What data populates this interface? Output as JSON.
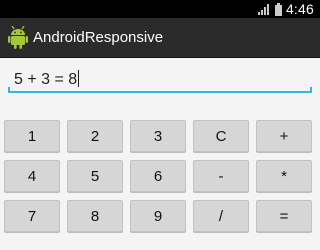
{
  "status_bar": {
    "time": "4:46",
    "signal_icon": "signal-bars-icon",
    "battery_icon": "battery-icon"
  },
  "app": {
    "title": "AndroidResponsive",
    "icon": "android-robot-icon"
  },
  "display": {
    "value": "5 + 3 = 8"
  },
  "keypad": {
    "rows": [
      [
        {
          "label": "1",
          "name": "key-1"
        },
        {
          "label": "2",
          "name": "key-2"
        },
        {
          "label": "3",
          "name": "key-3"
        },
        {
          "label": "C",
          "name": "key-clear"
        },
        {
          "label": "+",
          "name": "key-plus"
        }
      ],
      [
        {
          "label": "4",
          "name": "key-4"
        },
        {
          "label": "5",
          "name": "key-5"
        },
        {
          "label": "6",
          "name": "key-6"
        },
        {
          "label": "-",
          "name": "key-minus"
        },
        {
          "label": "*",
          "name": "key-multiply"
        }
      ],
      [
        {
          "label": "7",
          "name": "key-7"
        },
        {
          "label": "8",
          "name": "key-8"
        },
        {
          "label": "9",
          "name": "key-9"
        },
        {
          "label": "/",
          "name": "key-divide"
        },
        {
          "label": "=",
          "name": "key-equals"
        }
      ]
    ]
  },
  "colors": {
    "status_bar": "#000000",
    "action_bar": "#2b2b2b",
    "accent": "#33b5e5",
    "key": "#d6d6d6",
    "background": "#f4f4f4"
  }
}
